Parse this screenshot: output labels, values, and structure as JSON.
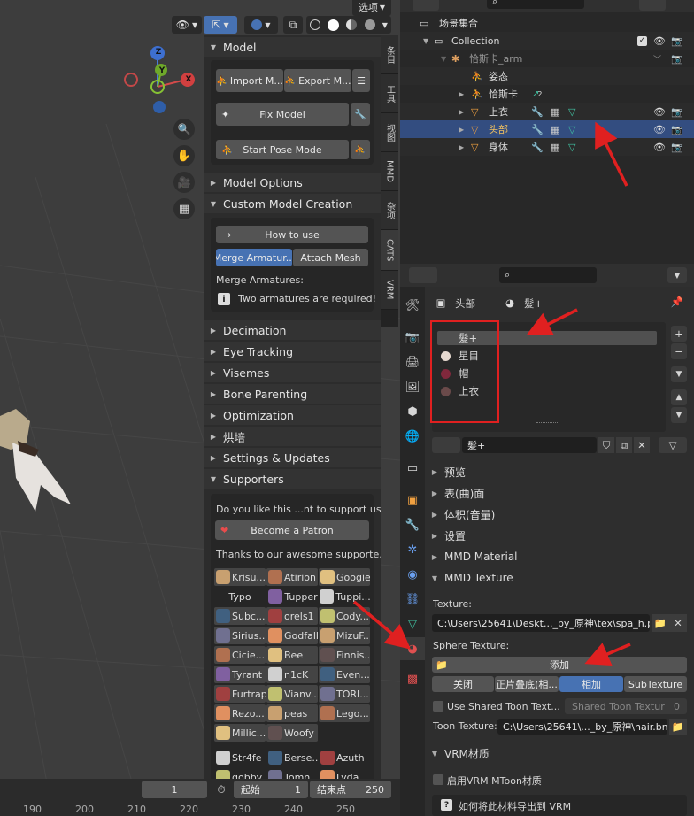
{
  "viewport": {
    "select_mode": "选项",
    "gizmo": {
      "z": "Z",
      "y": "Y",
      "x": "X"
    },
    "ruler": [
      "190",
      "200",
      "210",
      "220",
      "230",
      "240",
      "250"
    ]
  },
  "npanel": {
    "tabs": [
      "条目",
      "工具",
      "视图",
      "MMD",
      "杂项",
      "CATS",
      "VRM"
    ],
    "model": {
      "title": "Model",
      "import_label": "Import M...",
      "export_label": "Export M...",
      "fix_label": "Fix Model",
      "pose_label": "Start Pose Mode"
    },
    "model_options": "Model Options",
    "custom": {
      "title": "Custom Model Creation",
      "how_to": "How to use",
      "merge_tab": "Merge Armatur...",
      "attach_tab": "Attach Mesh",
      "merge_heading": "Merge Armatures:",
      "warning": "Two armatures are required!"
    },
    "sections": [
      "Decimation",
      "Eye Tracking",
      "Visemes",
      "Bone Parenting",
      "Optimization",
      "烘培",
      "Settings & Updates"
    ],
    "supporters": {
      "title": "Supporters",
      "question": "Do you like this ...nt to support us?",
      "patron": "Become a Patron",
      "thanks": "Thanks to our awesome supporte...",
      "names": [
        [
          "Krisu...",
          "Atirion",
          "Googie"
        ],
        [
          "Typo",
          "Tupper",
          "Tuppi..."
        ],
        [
          "Subc...",
          "orels1",
          "Cody..."
        ],
        [
          "Sirius...",
          "Godfall",
          "MizuF..."
        ],
        [
          "Cicie...",
          "Bee",
          "Finnis..."
        ],
        [
          "Tyrant",
          "n1cK",
          "Even..."
        ],
        [
          "Furtrap",
          "Vianv...",
          "TORI..."
        ],
        [
          "Rezo...",
          "peas",
          "Lego..."
        ],
        [
          "Millic...",
          "Woofy",
          ""
        ],
        [
          "Str4fe",
          "Berse...",
          "Azuth"
        ],
        [
          "gobby",
          "Tomn...",
          "Lyda..."
        ]
      ]
    }
  },
  "timeline": {
    "frame": "1",
    "start_label": "起始",
    "start_value": "1",
    "end_label": "结束点",
    "end_value": "250"
  },
  "outliner": {
    "root": "场景集合",
    "rows": [
      {
        "label": "Collection"
      },
      {
        "label": "恰斯卡_arm"
      },
      {
        "label": "姿态"
      },
      {
        "label": "恰斯卡",
        "badge": "2"
      },
      {
        "label": "上衣"
      },
      {
        "label": "头部"
      },
      {
        "label": "身体"
      }
    ]
  },
  "properties": {
    "breadcrumb_object": "头部",
    "breadcrumb_material": "髮+",
    "slots": [
      "髮+",
      "星目",
      "帽",
      "上衣"
    ],
    "material_name": "髮+",
    "sections": [
      "预览",
      "表(曲)面",
      "体积(音量)",
      "设置",
      "MMD Material"
    ],
    "mmd_texture": {
      "title": "MMD Texture",
      "texture_label": "Texture:",
      "texture_path": "C:\\Users\\25641\\Deskt..._by_原神\\tex\\spa_h.png",
      "sphere_label": "Sphere Texture:",
      "add_label": "添加",
      "modes": [
        "关闭",
        "正片叠底(相...",
        "相加",
        "SubTexture"
      ],
      "use_shared": "Use Shared Toon Text...",
      "shared_toon": "Shared Toon Textur",
      "shared_value": "0",
      "toon_label": "Toon Texture:",
      "toon_path": "C:\\Users\\25641\\..._by_原神\\hair.bmp"
    },
    "vrm": {
      "title": "VRM材质",
      "enable": "启用VRM MToon材质",
      "help": "如何将此材料导出到 VRM"
    }
  },
  "colors": {
    "accent": "#4772b3",
    "selection": "#334d80",
    "annotation": "#e02020"
  }
}
